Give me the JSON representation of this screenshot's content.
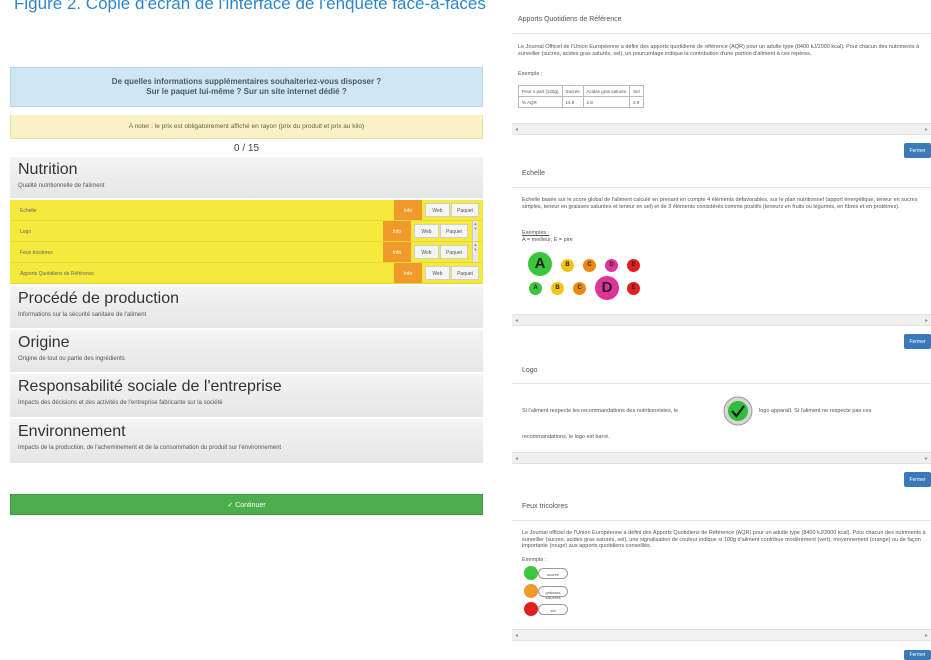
{
  "caption": "Figure 2. Copie d'écran de l'interface de l'enquête face-à-faces",
  "left": {
    "question_line1": "De quelles informations supplémentaires souhaiteriez-vous disposer ?",
    "question_line2": "Sur le paquet lui-même ? Sur un site internet dédié ?",
    "note": "A noter : le prix est obligatoirement affiché en rayon (prix du produit et prix au kilo)",
    "counter": "0 / 15",
    "nutrition": {
      "title": "Nutrition",
      "subtitle": "Qualité nutritionnelle de l'aliment",
      "rows": [
        {
          "label": "Echelle",
          "info": "Info",
          "btn1": "Web",
          "btn2": "Paquet"
        },
        {
          "label": "Logo",
          "info": "Info",
          "btn1": "Web",
          "btn2": "Paquet"
        },
        {
          "label": "Feux tricolores",
          "info": "Info",
          "btn1": "Web",
          "btn2": "Paquet"
        },
        {
          "label": "Apports Quotidiens de Référence",
          "info": "Info",
          "btn1": "Web",
          "btn2": "Paquet"
        }
      ]
    },
    "sections": [
      {
        "title": "Procédé de production",
        "subtitle": "Informations sur la sécurité sanitaire de l'aliment"
      },
      {
        "title": "Origine",
        "subtitle": "Origine de tout ou partie des ingrédients"
      },
      {
        "title": "Responsabilité sociale de l'entreprise",
        "subtitle": "Impacts des décisions et des activités de l'entreprise fabricante sur la société"
      },
      {
        "title": "Environnement",
        "subtitle": "Impacts de la production, de l'acheminement et de la consommation du produit sur l'environnement"
      }
    ],
    "continue_label": "Continuer",
    "continue_icon": "check-circle-icon"
  },
  "right": {
    "ajr": {
      "title": "Apports Quotidiens de Référence",
      "text": "Le Journal Officiel de l'Union Européenne a défini des apports quotidiens de référence (AQR) pour un adulte type (8400 kJ/2000 kcal). Pour chacun des nutriments à surveiller (sucres, acides gras saturés, sel), un pourcentage indique la contribution d'une portion d'aliment à ces repères.",
      "example": "Exemple :",
      "table_header": [
        "Pour 1 part (125g)",
        "Sucres",
        "Acides gras saturés",
        "Sel"
      ],
      "table_row": [
        "% AQR",
        "14.8",
        "2.8",
        "2.8"
      ]
    },
    "echelle": {
      "title": "Echelle",
      "text": "Echelle basée sur le score global de l'aliment calculé en prenant en compte 4 éléments défavorables, sur le plan nutritionnel (apport énergétique, teneur en sucres simples, teneur en graisses saturées et teneur en sel) et de 3 éléments considérés comme positifs (teneurs en fruits ou légumes, en fibres et en protéines).",
      "examples_label": "Exemples :",
      "legend": "A = meilleur, E = pire",
      "row1": [
        "A",
        "B",
        "C",
        "D",
        "E"
      ],
      "row2": [
        "A",
        "B",
        "C",
        "D",
        "E"
      ],
      "colors": [
        "#3cc63c",
        "#f2c418",
        "#ee8a12",
        "#e0339a",
        "#e02020"
      ]
    },
    "logo": {
      "title": "Logo",
      "text1": "Si l'aliment respecte les recommandations des nutritionnistes, le",
      "text2": "logo apparaît. Si l'aliment ne respecte pas ces",
      "text3": "recommandations, le logo est barré.",
      "icon": "check-badge-icon"
    },
    "feux": {
      "title": "Feux tricolores",
      "text": "Le Journal officiel de l'Union Européenne a défini des Apports Quotidiens de Référence (AQR) pour un adulte type (8400 kJ/2000 kcal). Pour chacun des nutriments à surveiller (sucres, acides gras saturés, sel), une signalisation de couleur indique si 100g d'aliment contribue modérément (vert), moyennement (orange) ou de façon importante (rouge) aux apports quotidiens conseillés.",
      "example": "Exemple :",
      "items": [
        "sucres",
        "graisses saturées",
        "sel"
      ],
      "colors": [
        "#3cc63c",
        "#ee9a2a",
        "#e02020"
      ]
    },
    "fermer_label": "Fermer"
  }
}
